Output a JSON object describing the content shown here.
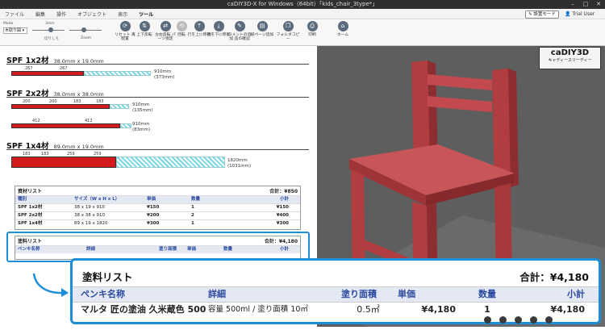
{
  "window": {
    "title": "caDIY3D-X for Windows（64bit）「kids_chair_3type*」",
    "controls": [
      "–",
      "□",
      "✕"
    ]
  },
  "menu": {
    "items": [
      "ファイル",
      "編集",
      "操作",
      "オブジェクト",
      "表示",
      "ツール"
    ],
    "active": "ツール"
  },
  "mode_button": "✎ 設置モード",
  "user": "Trial User",
  "ribbon": {
    "mode_label": "Mode",
    "mode_value": "木取り図",
    "size_label": "3mm",
    "cut_label": "切りしろ",
    "zoom_label": "Zoom",
    "buttons": [
      {
        "label": "リセット 再配置",
        "icon": "refresh-icon",
        "glyph": "⟳",
        "disabled": false
      },
      {
        "label": "上下反転",
        "icon": "flip-vertical-icon",
        "glyph": "⇅",
        "disabled": false
      },
      {
        "label": "左右反転 パーツ指定",
        "icon": "flip-horizontal-icon",
        "glyph": "⇄",
        "disabled": false
      },
      {
        "label": "回転",
        "icon": "rotate-icon",
        "glyph": "⟲",
        "disabled": true
      },
      {
        "label": "行を上に移動",
        "icon": "row-up-icon",
        "glyph": "⤒",
        "disabled": false
      },
      {
        "label": "行を下に移動",
        "icon": "row-down-icon",
        "glyph": "⤓",
        "disabled": false
      },
      {
        "label": "コメントの追加 品の確認",
        "icon": "comment-icon",
        "glyph": "✎",
        "disabled": false
      },
      {
        "label": "紙ページ追加",
        "icon": "page-add-icon",
        "glyph": "▤",
        "disabled": false
      },
      {
        "label": "フォルダコピー",
        "icon": "folder-copy-icon",
        "glyph": "❐",
        "disabled": false
      },
      {
        "label": "印刷",
        "icon": "print-icon",
        "glyph": "⎙",
        "disabled": false
      },
      {
        "label": "ホーム",
        "icon": "home-icon",
        "glyph": "⌂",
        "disabled": false
      }
    ]
  },
  "lumber": [
    {
      "name": "SPF 1x2材",
      "size": "38.0mm x 19.0mm",
      "dims": [
        "267",
        "267"
      ],
      "remain": "910mm",
      "remain_sub": "(373mm)"
    },
    {
      "name": "SPF 2x2材",
      "size": "38.0mm x 38.0mm",
      "dims": [
        "200",
        "200",
        "183",
        "183"
      ],
      "remain": "910mm",
      "remain_sub": "(135mm)",
      "dims2": [
        "412",
        "412"
      ],
      "remain2": "910mm",
      "remain2_sub": "(83mm)"
    },
    {
      "name": "SPF 1x4材",
      "size": "89.0mm x 19.0mm",
      "dims": [
        "183",
        "183",
        "259",
        "259"
      ],
      "remain": "1820mm",
      "remain_sub": "(1031mm)"
    }
  ],
  "materials": {
    "title": "資材リスト",
    "total": "合計：¥850",
    "headers": [
      "種別",
      "サイズ（W x H x L）",
      "単価",
      "数量",
      "小計"
    ],
    "rows": [
      [
        "SPF 1x2材",
        "38 x 19 x 910",
        "¥150",
        "1",
        "¥150"
      ],
      [
        "SPF 2x2材",
        "38 x 38 x 910",
        "¥200",
        "2",
        "¥400"
      ],
      [
        "SPF 1x4材",
        "89 x 19 x 1820",
        "¥300",
        "1",
        "¥300"
      ]
    ]
  },
  "paint": {
    "title": "塗料リスト",
    "total": "合計：¥4,180",
    "headers": [
      "ペンキ名称",
      "詳細",
      "塗り面積",
      "単価",
      "数量",
      "小計"
    ],
    "rows": [
      [
        "マルタ 匠の塗油 久米蔵色 500",
        "容量 500ml / 塗り面積 10㎡",
        "0.5㎡",
        "¥4,180",
        "1",
        "¥4,180"
      ]
    ]
  },
  "logo": {
    "main": "caDIY3D",
    "sub": "キャディースリーディー"
  },
  "colors": {
    "accent": "#1e8ed8",
    "board": "#d41a1a",
    "chair": "#c0474a"
  }
}
